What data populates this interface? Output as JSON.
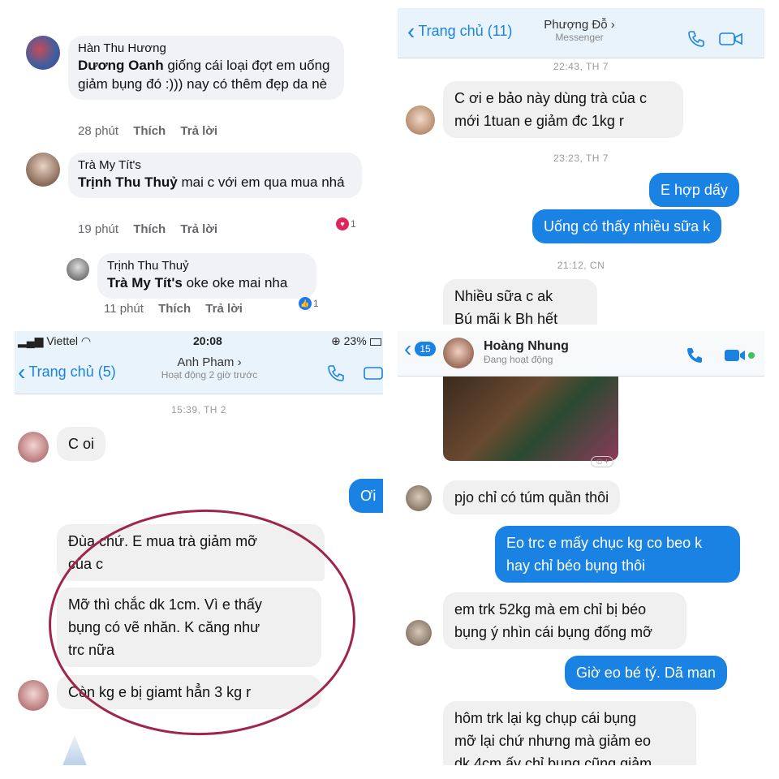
{
  "panel1": {
    "comments": [
      {
        "name": "Hàn Thu Hương",
        "mention": "Dương Oanh",
        "text": " giống cái loại đợt em uống giảm bụng đó :))) nay có thêm đẹp da nè",
        "time": "28 phút",
        "like": "Thích",
        "reply": "Trả lời"
      },
      {
        "name": "Trà My Tít's",
        "mention": "Trịnh Thu Thuỷ",
        "text": " mai c với em qua mua nhá",
        "time": "19 phút",
        "like": "Thích",
        "reply": "Trả lời",
        "reaction_count": "1"
      },
      {
        "name": "Trịnh Thu Thuỷ",
        "mention": "Trà My Tít's",
        "text": " oke oke mai nha",
        "time": "11 phút",
        "like": "Thích",
        "reply": "Trả lời",
        "reaction_count": "1"
      }
    ]
  },
  "panel2": {
    "back_label": "Trang chủ (11)",
    "contact": "Phượng Đỗ",
    "contact_sub": "Messenger",
    "ts1": "22:43, TH 7",
    "msg1_line1": "C ơi e bảo này dùng trà của c",
    "msg1_line2": "mới 1tuan e giảm đc 1kg r",
    "ts2": "23:23, TH 7",
    "out1": "E hợp dấy",
    "out2": "Uống có thấy nhiều sữa k",
    "ts3": "21:12, CN",
    "msg2_line1": "Nhiều sữa c ak",
    "msg2_line2": "Bú mãi k Bh hết"
  },
  "panel3": {
    "carrier": "Viettel",
    "time": "20:08",
    "battery": "23%",
    "back_label": "Trang chủ (5)",
    "contact": "Anh Pham",
    "contact_sub": "Hoạt động 2 giờ trước",
    "ts1": "15:39, TH 2",
    "msg1": "C oi",
    "out1": "Ơi",
    "msg2_line1": "Đùa chứ. E mua trà giảm mỡ",
    "msg2_line2": "của c",
    "msg3_line1": "Mỡ thì chắc dk 1cm. Vì e thấy",
    "msg3_line2": "bụng có vẽ nhăn. K căng như",
    "msg3_line3": "trc nữa",
    "msg4": "Còn kg e bị giamt hẳn 3 kg r"
  },
  "panel4": {
    "badge": "15",
    "contact": "Hoàng Nhung",
    "contact_sub": "Đang hoạt động",
    "msg1": "pjo chỉ có túm quần thôi",
    "out1_line1": "Eo trc e mấy chục kg co beo k",
    "out1_line2": "hay chỉ béo bụng thôi",
    "msg2_line1": "em trk 52kg mà em chỉ bị béo",
    "msg2_line2": "bụng ý nhìn cái bụng đống mỡ",
    "out2": "Giờ eo bé tý. Dã man",
    "msg3_line1": "hôm trk lại kg chụp cái bụng",
    "msg3_line2": "mỡ lại chứ nhưng mà giảm eo",
    "msg3_line3": "dk 4cm ấy chỉ bụng cũng giảm"
  }
}
